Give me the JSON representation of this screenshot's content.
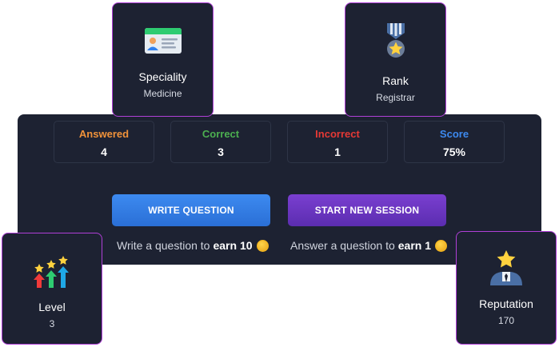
{
  "cards": {
    "speciality": {
      "title": "Speciality",
      "value": "Medicine",
      "icon": "id-card-icon"
    },
    "rank": {
      "title": "Rank",
      "value": "Registrar",
      "icon": "medal-icon"
    },
    "level": {
      "title": "Level",
      "value": "3",
      "icon": "level-up-arrows-icon"
    },
    "reputation": {
      "title": "Reputation",
      "value": "170",
      "icon": "user-star-icon"
    }
  },
  "stats": [
    {
      "label": "Answered",
      "value": "4",
      "color": "#f0923a"
    },
    {
      "label": "Correct",
      "value": "3",
      "color": "#4caf50"
    },
    {
      "label": "Incorrect",
      "value": "1",
      "color": "#e53935"
    },
    {
      "label": "Score",
      "value": "75%",
      "color": "#3d8af0"
    }
  ],
  "actions": {
    "write_label": "WRITE QUESTION",
    "start_label": "START NEW SESSION",
    "write_hint_prefix": "Write a question to",
    "write_hint_reward": "earn 10",
    "answer_hint_prefix": "Answer a question to",
    "answer_hint_reward": "earn 1"
  },
  "colors": {
    "panel_bg": "#1d2232",
    "card_border": "#b040d8",
    "write_button": "#3d8af0",
    "start_button": "#6a35c4"
  }
}
